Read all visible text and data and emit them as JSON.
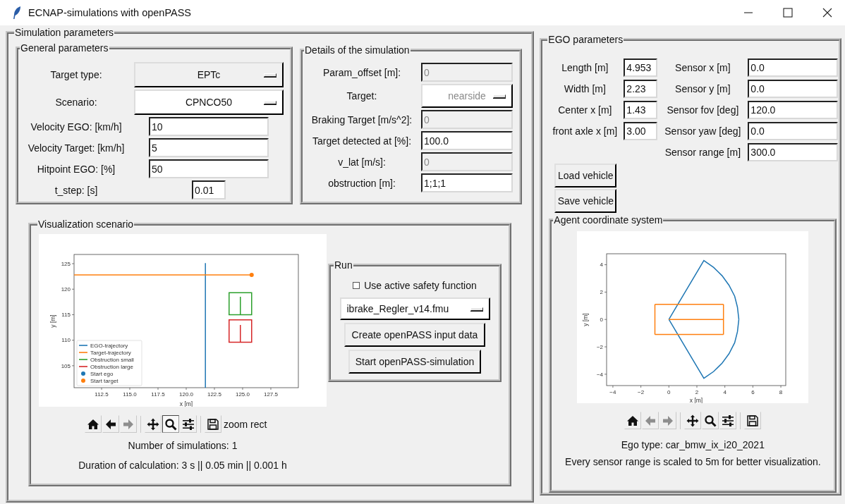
{
  "window": {
    "title": "ECNAP-simulations with openPASS"
  },
  "simulation_parameters": {
    "title": "Simulation parameters",
    "general": {
      "title": "General parameters",
      "rows": [
        {
          "kind": "dropdown",
          "label": "Target type:",
          "value": "EPTc",
          "active": true,
          "disabled": false
        },
        {
          "kind": "dropdown",
          "label": "Scenario:",
          "value": "CPNCO50",
          "active": false,
          "disabled": false
        },
        {
          "kind": "entry",
          "label": "Velocity EGO: [km/h]",
          "value": "10",
          "active": false,
          "disabled": false
        },
        {
          "kind": "entry",
          "label": "Velocity Target: [km/h]",
          "value": "5",
          "active": false,
          "disabled": false
        },
        {
          "kind": "entry",
          "label": "Hitpoint EGO: [%]",
          "value": "50",
          "active": false,
          "disabled": false
        },
        {
          "kind": "short_entry",
          "label": "t_step: [s]",
          "value": "0.01",
          "active": false,
          "disabled": false
        }
      ]
    },
    "details": {
      "title": "Details of the simulation",
      "rows": [
        {
          "kind": "entry",
          "label": "Param_offset [m]:",
          "value": "0",
          "active": false,
          "disabled": true
        },
        {
          "kind": "dropdown",
          "label": "Target:",
          "value": "nearside",
          "active": false,
          "disabled": true
        },
        {
          "kind": "entry",
          "label": "Braking Target [m/s^2]:",
          "value": "0",
          "active": false,
          "disabled": true
        },
        {
          "kind": "entry",
          "label": "Target detected at [%]:",
          "value": "100.0",
          "active": false,
          "disabled": false
        },
        {
          "kind": "entry",
          "label": "v_lat [m/s]:",
          "value": "0",
          "active": false,
          "disabled": true
        },
        {
          "kind": "entry",
          "label": "obstruction [m]:",
          "value": "1;1;1",
          "active": false,
          "disabled": false
        }
      ]
    },
    "visualization": {
      "title": "Visualization scenario",
      "chart_data": {
        "type": "line",
        "legend": "lower left",
        "xlabel": "x [m]",
        "ylabel": "y [m]",
        "xlim": [
          110.06,
          129.94
        ],
        "ylim": [
          100.7,
          126.8
        ],
        "xticks": [
          112.5,
          {
            "value": 115,
            "label": "115.0"
          },
          117.5,
          {
            "value": 120,
            "label": "120.0"
          },
          122.5,
          {
            "value": 125,
            "label": "125.0"
          },
          127.5
        ],
        "yticks": [
          105,
          110,
          115,
          120,
          125
        ],
        "series": [
          {
            "name": "EGO-trajectory",
            "color": "#1f77b4",
            "type": "line",
            "x": [
              121.7,
              121.7
            ],
            "values": [
              100.7,
              125.1
            ]
          },
          {
            "name": "Target-trajectory",
            "color": "#ff7f0e",
            "type": "line",
            "x": [
              110.06,
              125.8
            ],
            "values": [
              122.8,
              122.8
            ]
          },
          {
            "name": "Obstruction small",
            "color": "#2ca02c",
            "type": "line"
          },
          {
            "name": "Obstruction large",
            "color": "#d62728",
            "type": "line"
          },
          {
            "name": "Start ego",
            "color": "#1f77b4",
            "type": "scatter"
          },
          {
            "name": "Start target",
            "color": "#ff7f0e",
            "type": "scatter",
            "x": [
              125.8
            ],
            "values": [
              122.8
            ]
          }
        ]
      },
      "toolbar": {
        "groups": [
          [
            {
              "kind": "home",
              "disabled": false,
              "selected": false
            },
            {
              "kind": "back",
              "disabled": false,
              "selected": false
            },
            {
              "kind": "forward",
              "disabled": true,
              "selected": false
            }
          ],
          [
            {
              "kind": "pan",
              "disabled": false,
              "selected": false
            },
            {
              "kind": "zoom",
              "disabled": false,
              "selected": true
            },
            {
              "kind": "configure",
              "disabled": false,
              "selected": false
            }
          ],
          [
            {
              "kind": "save",
              "disabled": false,
              "selected": false
            }
          ]
        ],
        "message": "zoom rect"
      },
      "info": [
        "Number of simulations: 1",
        "Duration of calculation: 3 s || 0.05 min || 0.001 h"
      ],
      "run": {
        "title": "Run",
        "checkbox": {
          "label": "Use active safety function",
          "checked": false
        },
        "dropdown": {
          "value": "ibrake_Regler_v14.fmu"
        },
        "buttons": [
          "Create openPASS input data",
          "Start openPASS-simulation"
        ]
      }
    }
  },
  "ego_parameters": {
    "title": "EGO parameters",
    "vehicle_fields": [
      {
        "label": "Length [m]",
        "value": "4.953"
      },
      {
        "label": "Width [m]",
        "value": "2.23"
      },
      {
        "label": "Center x [m]",
        "value": "1.43"
      },
      {
        "label": "front axle x [m]",
        "value": "3.00"
      }
    ],
    "sensor_fields": [
      {
        "label": "Sensor x [m]",
        "value": "0.0"
      },
      {
        "label": "Sensor y [m]",
        "value": "0.0"
      },
      {
        "label": "Sensor fov [deg]",
        "value": "120.0"
      },
      {
        "label": "Sensor yaw [deg]",
        "value": "0.0"
      },
      {
        "label": "Sensor range [m]",
        "value": "300.0"
      }
    ],
    "buttons": [
      "Load vehicle",
      "Save vehicle"
    ],
    "agent_coordinate_system": {
      "title": "Agent coordinate system",
      "chart_data": {
        "type": "line",
        "xlabel": "x [m]",
        "ylabel": "y [m]",
        "xlim": [
          -4.45,
          8.35
        ],
        "ylim": [
          -4.83,
          4.8
        ],
        "xticks": [
          {
            "value": -4,
            "label": "−4"
          },
          {
            "value": -2,
            "label": "−2"
          },
          0,
          2,
          4,
          6,
          8
        ],
        "yticks": [
          {
            "value": -4,
            "label": "−4"
          },
          {
            "value": -2,
            "label": "−2"
          },
          0,
          2,
          4
        ],
        "series": [
          {
            "color": "#1f77b4",
            "type": "line",
            "x": [
              0,
              2.5,
              3.2,
              3.8,
              4.3,
              4.7,
              4.9,
              5,
              null,
              0,
              2.5,
              3.2,
              3.8,
              4.3,
              4.7,
              4.9,
              5
            ],
            "values": [
              0,
              4.3,
              3.8,
              3.2,
              2.5,
              1.7,
              0.9,
              0,
              null,
              0,
              -4.3,
              -3.8,
              -3.2,
              -2.5,
              -1.7,
              -0.9,
              0
            ]
          },
          {
            "color": "#ff7f0e",
            "type": "line",
            "x": [
              -1,
              3.9
            ],
            "values": [
              1.1,
              1.1
            ]
          },
          {
            "color": "#ff7f0e",
            "type": "line",
            "x": [
              -1,
              3.9
            ],
            "values": [
              -1.1,
              -1.1
            ]
          },
          {
            "color": "#ff7f0e",
            "type": "line",
            "x": [
              0,
              3.9
            ],
            "values": [
              0,
              0
            ]
          },
          {
            "color": "#ff7f0e",
            "type": "line",
            "x": [
              -1,
              -1
            ],
            "values": [
              -1.1,
              1.1
            ]
          },
          {
            "color": "#ff7f0e",
            "type": "line",
            "x": [
              3.9,
              3.9
            ],
            "values": [
              -1.1,
              1.1
            ]
          }
        ]
      },
      "toolbar": {
        "groups": [
          [
            {
              "kind": "home",
              "disabled": false,
              "selected": false
            },
            {
              "kind": "back",
              "disabled": true,
              "selected": false
            },
            {
              "kind": "forward",
              "disabled": true,
              "selected": false
            }
          ],
          [
            {
              "kind": "pan",
              "disabled": false,
              "selected": false
            },
            {
              "kind": "zoom",
              "disabled": false,
              "selected": false
            },
            {
              "kind": "configure",
              "disabled": false,
              "selected": false
            }
          ],
          [
            {
              "kind": "save",
              "disabled": false,
              "selected": false
            }
          ]
        ]
      },
      "info": [
        "Ego type: car_bmw_ix_i20_2021",
        "Every sensor range is scaled to 5m for better visualization."
      ]
    }
  }
}
